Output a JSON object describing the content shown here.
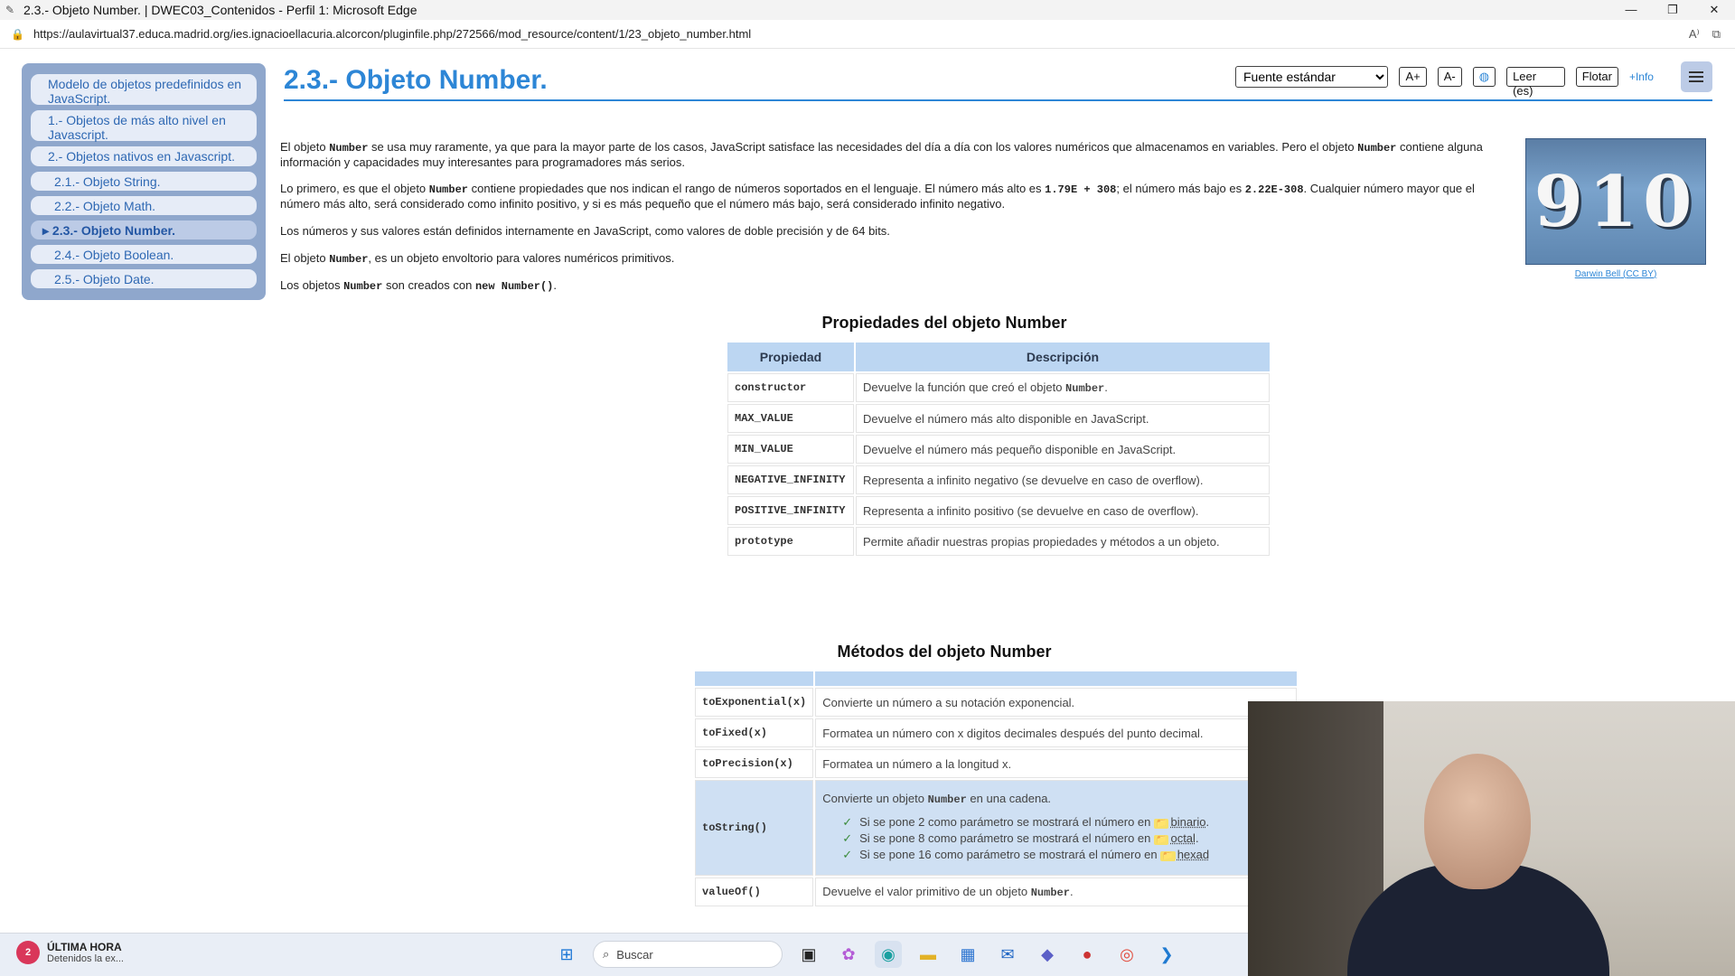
{
  "window": {
    "title": "2.3.- Objeto Number. | DWEC03_Contenidos - Perfil 1: Microsoft Edge",
    "controls": [
      "—",
      "❐",
      "✕"
    ]
  },
  "browser": {
    "url": "https://aulavirtual37.educa.madrid.org/ies.ignacioellacuria.alcorcon/pluginfile.php/272566/mod_resource/content/1/23_objeto_number.html",
    "read_aloud_icon": "A⁾",
    "split_icon": "⧉"
  },
  "sidebar": {
    "items": [
      {
        "label": "Modelo de objetos predefinidos en JavaScript."
      },
      {
        "label": "1.- Objetos de más alto nivel en Javascript."
      },
      {
        "label": "2.- Objetos nativos en Javascript."
      },
      {
        "label": "2.1.- Objeto String."
      },
      {
        "label": "2.2.- Objeto Math."
      },
      {
        "label": "2.3.- Objeto Number."
      },
      {
        "label": "2.4.- Objeto Boolean."
      },
      {
        "label": "2.5.- Objeto Date."
      }
    ]
  },
  "toolbar": {
    "font_select": "Fuente estándar",
    "a_plus": "A+",
    "a_minus": "A-",
    "read": "Leer (es)",
    "float": "Flotar",
    "info": "+Info"
  },
  "page": {
    "title": "2.3.- Objeto Number.",
    "p1a": "El objeto ",
    "p1b": "Number",
    "p1c": " se usa muy raramente, ya que para la mayor parte de los casos, JavaScript satisface las necesidades del día a día con los valores numéricos que almacenamos en variables. Pero el objeto ",
    "p1d": "Number",
    "p1e": " contiene alguna información y capacidades muy interesantes para programadores más serios.",
    "p2a": "Lo primero, es que el objeto ",
    "p2b": "Number",
    "p2c": " contiene propiedades que nos indican el rango de números soportados en el lenguaje. El número más alto es ",
    "p2d": "1.79E + 308",
    "p2e": "; el número más bajo es ",
    "p2f": "2.22E-308",
    "p2g": ". Cualquier número mayor que el número más alto, será considerado como infinito positivo, y si es más pequeño que el número más bajo, será considerado infinito negativo.",
    "p3": "Los números y sus valores están definidos internamente en JavaScript, como valores de doble precisión y de 64 bits.",
    "p4a": "El objeto ",
    "p4b": "Number",
    "p4c": ", es un objeto envoltorio para valores numéricos primitivos.",
    "p5a": "Los objetos ",
    "p5b": "Number",
    "p5c": " son creados con ",
    "p5d": "new Number()",
    "p5e": ".",
    "image_text": "910",
    "credit_author": "Darwin Bell",
    "credit_license": "CC BY"
  },
  "props": {
    "title": "Propiedades del objeto Number",
    "headers": [
      "Propiedad",
      "Descripción"
    ],
    "rows": [
      {
        "k": "constructor",
        "d1": "Devuelve la función que creó el objeto ",
        "d2": "Number",
        "d3": "."
      },
      {
        "k": "MAX_VALUE",
        "d1": "Devuelve el número más alto disponible en JavaScript."
      },
      {
        "k": "MIN_VALUE",
        "d1": "Devuelve el número más pequeño disponible en JavaScript."
      },
      {
        "k": "NEGATIVE_INFINITY",
        "d1": "Representa a infinito negativo (se devuelve en caso de overflow)."
      },
      {
        "k": "POSITIVE_INFINITY",
        "d1": "Representa a infinito positivo (se devuelve en caso de overflow)."
      },
      {
        "k": "prototype",
        "d1": "Permite añadir nuestras propias propiedades y métodos a un objeto."
      }
    ]
  },
  "methods": {
    "title": "Métodos del objeto Number",
    "rows": [
      {
        "k": "toExponential(x)",
        "d": "Convierte un número a su notación exponencial."
      },
      {
        "k": "toFixed(x)",
        "d": "Formatea un número con x digitos decimales después del punto decimal."
      },
      {
        "k": "toPrecision(x)",
        "d": "Formatea un número a la longitud x."
      },
      {
        "k": "toString()",
        "d1": "Convierte un objeto ",
        "d2": "Number",
        "d3": " en una cadena.",
        "bullets": [
          {
            "t": "Si se pone 2 como parámetro se mostrará el número en ",
            "w": "binario",
            "e": "."
          },
          {
            "t": "Si se pone 8 como parámetro se mostrará el número en ",
            "w": "octal",
            "e": "."
          },
          {
            "t": "Si se pone 16 como parámetro se mostrará el número en ",
            "w": "hexad",
            "e": ""
          }
        ]
      },
      {
        "k": "valueOf()",
        "d1": "Devuelve el valor primitivo de un objeto ",
        "d2": "Number",
        "d3": "."
      }
    ]
  },
  "taskbar": {
    "news_badge": "2",
    "news_title": "ÚLTIMA HORA",
    "news_sub": "Detenidos la ex...",
    "search": "Buscar"
  }
}
